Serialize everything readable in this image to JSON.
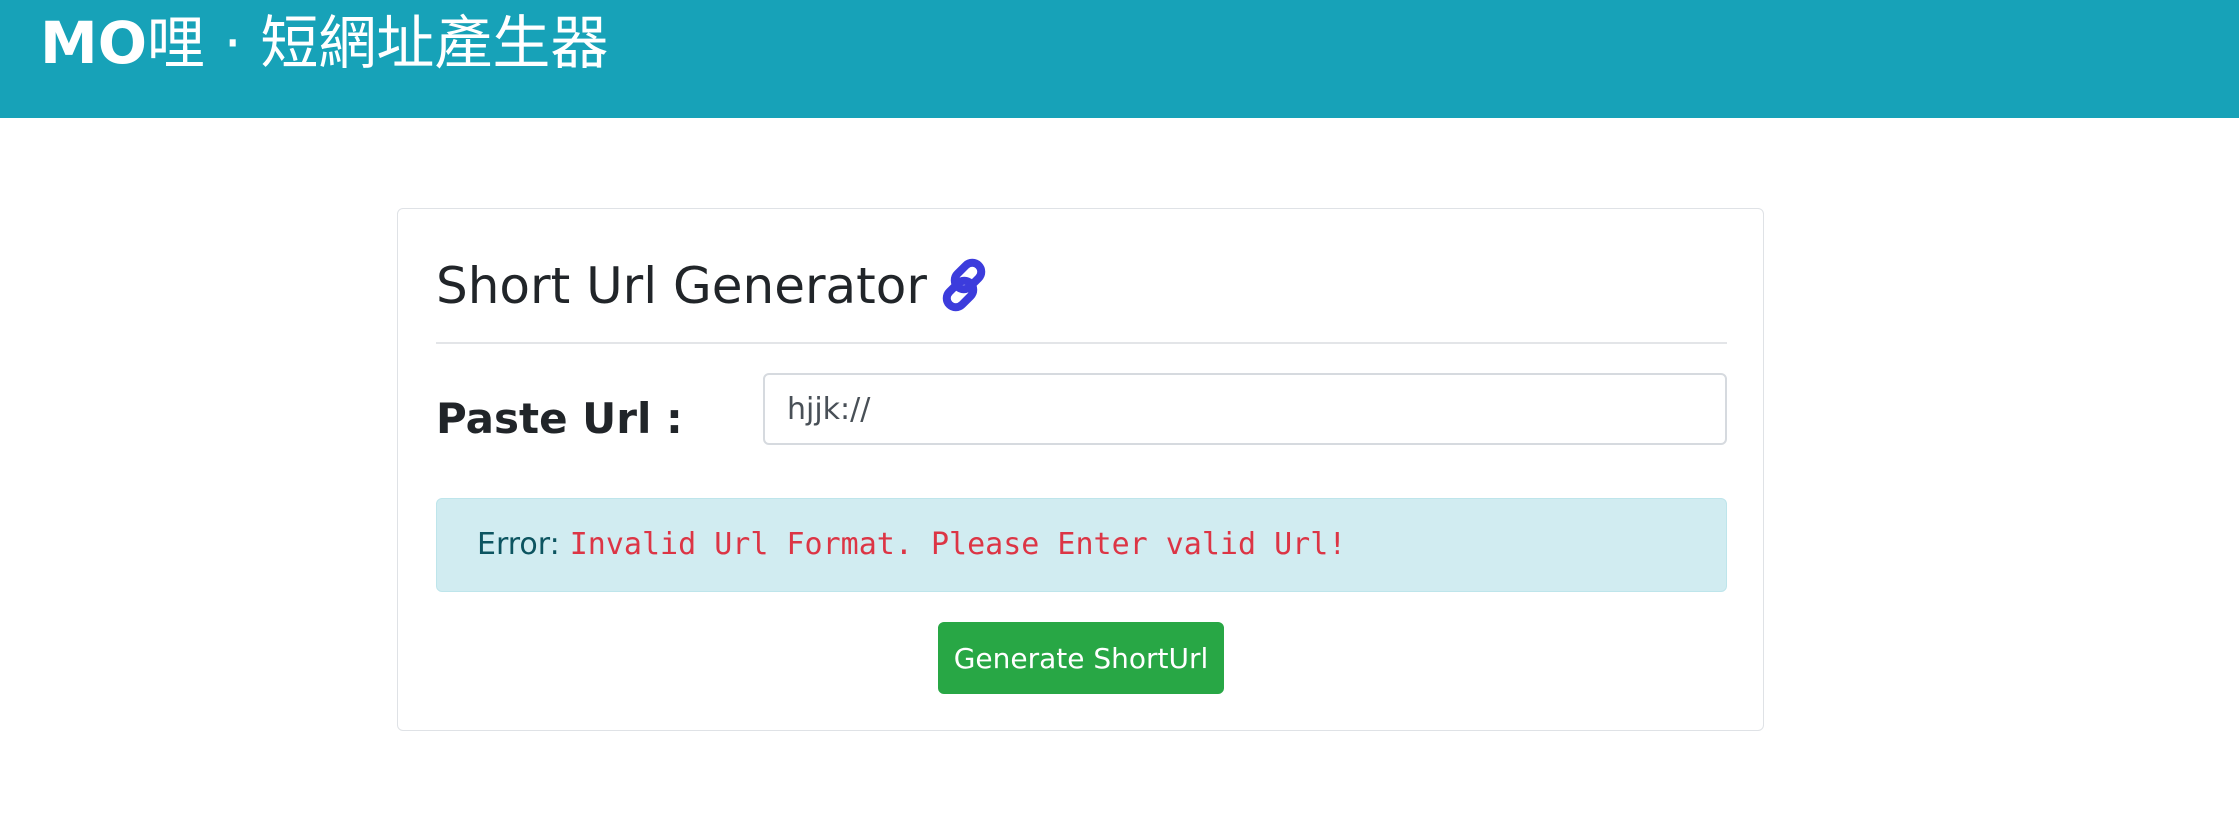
{
  "navbar": {
    "brand_strong": "MO",
    "brand_rest": "哩 · 短網址產生器"
  },
  "card": {
    "title": "Short Url Generator",
    "title_icon": "link-icon",
    "paste_label": "Paste Url :",
    "url_input_value": "hjjk://",
    "alert": {
      "prefix": "Error:",
      "message": "Invalid Url Format. Please Enter valid Url!"
    },
    "generate_button": "Generate ShortUrl"
  },
  "colors": {
    "navbar": "#17a2b8",
    "icon": "#3c3cdc",
    "alert_bg": "#d1ecf1",
    "error_text": "#dc3545",
    "button": "#28a745"
  }
}
